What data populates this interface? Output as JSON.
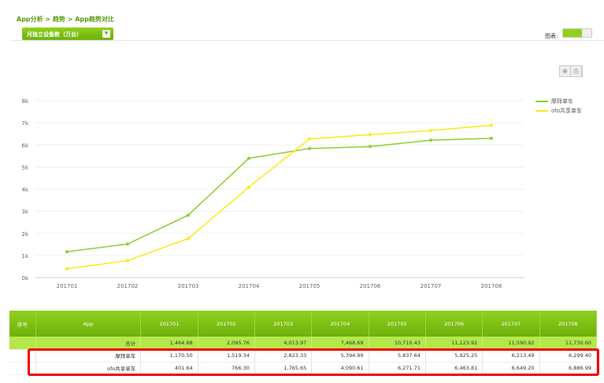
{
  "breadcrumb": "App分析 > 趋势 > App趋势对比",
  "dropdown": {
    "label": "月独立设备数（万台）"
  },
  "view_toggle": {
    "label": "图表:"
  },
  "chart_data": {
    "type": "line",
    "categories": [
      "201701",
      "201702",
      "201703",
      "201704",
      "201705",
      "201706",
      "201707",
      "201708"
    ],
    "ylim": [
      0,
      8000
    ],
    "yticks": [
      "0k",
      "1k",
      "2k",
      "3k",
      "4k",
      "5k",
      "6k",
      "7k",
      "8k"
    ],
    "legend_position": "top-right",
    "series": [
      {
        "name": "摩拜单车",
        "color": "#8ccf2e",
        "values": [
          1170.5,
          1519.34,
          2823.33,
          5394.99,
          5837.64,
          5925.25,
          6213.49,
          6299.4
        ]
      },
      {
        "name": "ofo共享单车",
        "color": "#ffe81a",
        "values": [
          401.64,
          766.3,
          1765.65,
          4090.61,
          6271.71,
          6463.81,
          6649.2,
          6886.99
        ]
      }
    ]
  },
  "table": {
    "headers": [
      "序号",
      "App",
      "201701",
      "201702",
      "201703",
      "201704",
      "201705",
      "201706",
      "201707",
      "201708"
    ],
    "total": {
      "label": "合计",
      "values": [
        "1,464.88",
        "2,095.76",
        "4,013.97",
        "7,468.69",
        "10,710.43",
        "11,123.92",
        "11,590.92",
        "11,730.60"
      ]
    },
    "rows": [
      {
        "app": "摩拜单车",
        "values": [
          "1,170.50",
          "1,519.34",
          "2,823.33",
          "5,394.99",
          "5,837.64",
          "5,925.25",
          "6,213.49",
          "6,299.40"
        ]
      },
      {
        "app": "ofo共享单车",
        "values": [
          "401.64",
          "766.30",
          "1,765.65",
          "4,090.61",
          "6,271.71",
          "6,463.81",
          "6,649.20",
          "6,886.99"
        ]
      }
    ]
  }
}
